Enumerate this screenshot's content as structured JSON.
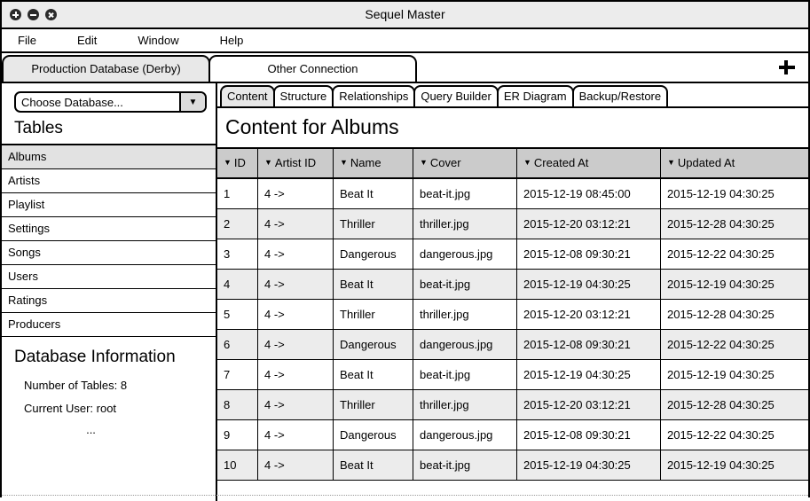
{
  "window": {
    "title": "Sequel Master",
    "controls": [
      {
        "name": "maximize",
        "glyph": "plus"
      },
      {
        "name": "minimize",
        "glyph": "minus"
      },
      {
        "name": "close",
        "glyph": "cross"
      }
    ]
  },
  "menubar": {
    "items": [
      "File",
      "Edit",
      "Window",
      "Help"
    ]
  },
  "connection_tabs": {
    "tabs": [
      {
        "label": "Production Database (Derby)",
        "active": true
      },
      {
        "label": "Other Connection",
        "active": false
      }
    ],
    "add_icon": "plus-icon"
  },
  "sidebar": {
    "database_select": {
      "value": "Choose Database...",
      "arrow_icon": "chevron-down-icon",
      "arrow_glyph": "▼"
    },
    "tables_heading": "Tables",
    "tables": [
      {
        "label": "Albums",
        "selected": true
      },
      {
        "label": "Artists",
        "selected": false
      },
      {
        "label": "Playlist",
        "selected": false
      },
      {
        "label": "Settings",
        "selected": false
      },
      {
        "label": "Songs",
        "selected": false
      },
      {
        "label": "Users",
        "selected": false
      },
      {
        "label": "Ratings",
        "selected": false
      },
      {
        "label": "Producers",
        "selected": false
      }
    ],
    "database_information": {
      "title": "Database Information",
      "lines": [
        "Number of Tables: 8",
        "Current User: root"
      ],
      "ellipsis": "..."
    }
  },
  "main": {
    "view_tabs": [
      {
        "label": "Content",
        "active": true
      },
      {
        "label": "Structure",
        "active": false
      },
      {
        "label": "Relationships",
        "active": false
      },
      {
        "label": "Query Builder",
        "active": false
      },
      {
        "label": "ER Diagram",
        "active": false
      },
      {
        "label": "Backup/Restore",
        "active": false
      }
    ],
    "content_title": "Content for Albums",
    "table": {
      "sort_caret": "▼",
      "columns": [
        "ID",
        "Artist ID",
        "Name",
        "Cover",
        "Created At",
        "Updated At"
      ],
      "rows": [
        [
          "1",
          "4 ->",
          "Beat It",
          "beat-it.jpg",
          "2015-12-19 08:45:00",
          "2015-12-19 04:30:25"
        ],
        [
          "2",
          "4 ->",
          "Thriller",
          "thriller.jpg",
          "2015-12-20 03:12:21",
          "2015-12-28 04:30:25"
        ],
        [
          "3",
          "4 ->",
          "Dangerous",
          "dangerous.jpg",
          "2015-12-08 09:30:21",
          "2015-12-22 04:30:25"
        ],
        [
          "4",
          "4 ->",
          "Beat It",
          "beat-it.jpg",
          "2015-12-19 04:30:25",
          "2015-12-19 04:30:25"
        ],
        [
          "5",
          "4 ->",
          "Thriller",
          "thriller.jpg",
          "2015-12-20 03:12:21",
          "2015-12-28 04:30:25"
        ],
        [
          "6",
          "4 ->",
          "Dangerous",
          "dangerous.jpg",
          "2015-12-08 09:30:21",
          "2015-12-22 04:30:25"
        ],
        [
          "7",
          "4 ->",
          "Beat It",
          "beat-it.jpg",
          "2015-12-19 04:30:25",
          "2015-12-19 04:30:25"
        ],
        [
          "8",
          "4 ->",
          "Thriller",
          "thriller.jpg",
          "2015-12-20 03:12:21",
          "2015-12-28 04:30:25"
        ],
        [
          "9",
          "4 ->",
          "Dangerous",
          "dangerous.jpg",
          "2015-12-08 09:30:21",
          "2015-12-22 04:30:25"
        ],
        [
          "10",
          "4 ->",
          "Beat It",
          "beat-it.jpg",
          "2015-12-19 04:30:25",
          "2015-12-19 04:30:25"
        ]
      ]
    }
  },
  "colors": {
    "titlebar_bg": "#ececec",
    "active_tab_bg": "#e8e8e8",
    "header_bg": "#cbcbcb",
    "row_alt_bg": "#ececec",
    "selected_item_bg": "#e2e2e2",
    "border": "#000000"
  }
}
